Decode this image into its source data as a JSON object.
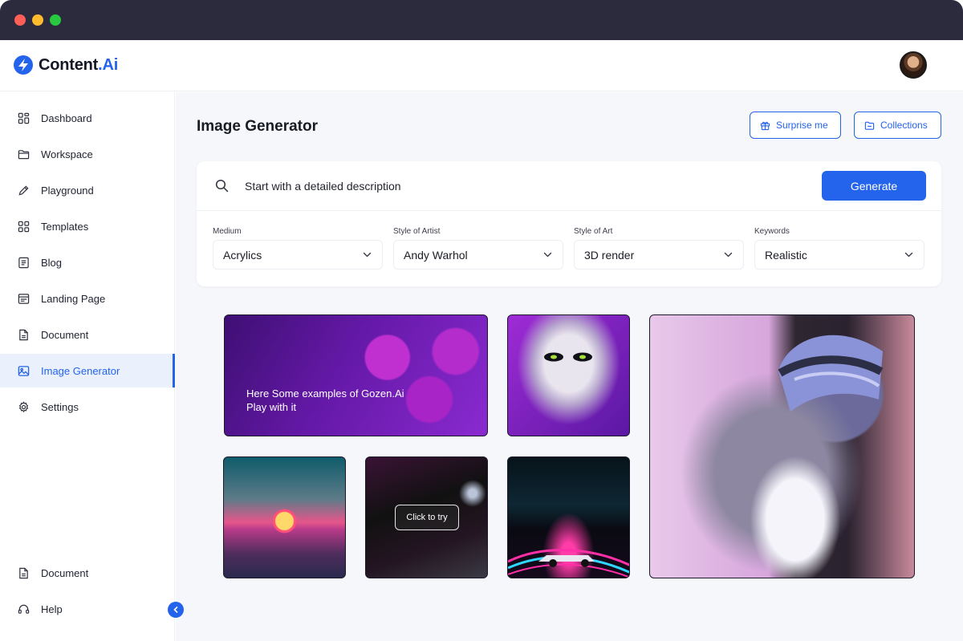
{
  "brand": {
    "name": "Content",
    "accent": ".Ai",
    "color": "#2463eb"
  },
  "sidebar": {
    "items": [
      {
        "label": "Dashboard",
        "icon": "dashboard-icon"
      },
      {
        "label": "Workspace",
        "icon": "folder-icon"
      },
      {
        "label": "Playground",
        "icon": "pencil-icon"
      },
      {
        "label": "Templates",
        "icon": "templates-icon"
      },
      {
        "label": "Blog",
        "icon": "blog-icon"
      },
      {
        "label": "Landing Page",
        "icon": "landing-page-icon"
      },
      {
        "label": "Document",
        "icon": "document-icon"
      },
      {
        "label": "Image Generator",
        "icon": "image-icon",
        "active": true
      },
      {
        "label": "Settings",
        "icon": "gear-icon"
      }
    ],
    "bottom_items": [
      {
        "label": "Document",
        "icon": "document-icon"
      },
      {
        "label": "Help",
        "icon": "headset-icon"
      }
    ]
  },
  "main": {
    "title": "Image Generator",
    "surprise_label": "Surprise me",
    "collections_label": "Collections",
    "search_placeholder": "Start with a detailed description",
    "generate_label": "Generate",
    "filters": [
      {
        "label": "Medium",
        "value": "Acrylics"
      },
      {
        "label": "Style of Artist",
        "value": "Andy Warhol"
      },
      {
        "label": "Style of Art",
        "value": "3D render"
      },
      {
        "label": "Keywords",
        "value": "Realistic"
      }
    ],
    "gallery": {
      "intro_line1": "Here Some examples of Gozen.Ai",
      "intro_line2": "Play with it",
      "try_label": "Click to try"
    }
  }
}
